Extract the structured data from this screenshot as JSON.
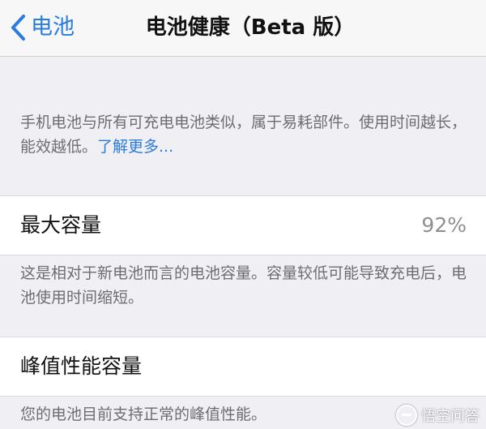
{
  "navbar": {
    "back_label": "电池",
    "title": "电池健康（Beta 版）"
  },
  "intro": {
    "text": "手机电池与所有可充电电池类似，属于易耗部件。使用时间越长，能效越低。",
    "link_label": "了解更多..."
  },
  "maximum_capacity": {
    "label": "最大容量",
    "value": "92%",
    "footer": "这是相对于新电池而言的电池容量。容量较低可能导致充电后，电池使用时间缩短。"
  },
  "peak_performance": {
    "label": "峰值性能容量",
    "footer": "您的电池目前支持正常的峰值性能。"
  },
  "watermark": {
    "text": "悟空问答"
  },
  "colors": {
    "accent": "#2a7bde",
    "background": "#efeff4",
    "secondary_text": "#6d6d72",
    "value_text": "#8e8e93"
  }
}
